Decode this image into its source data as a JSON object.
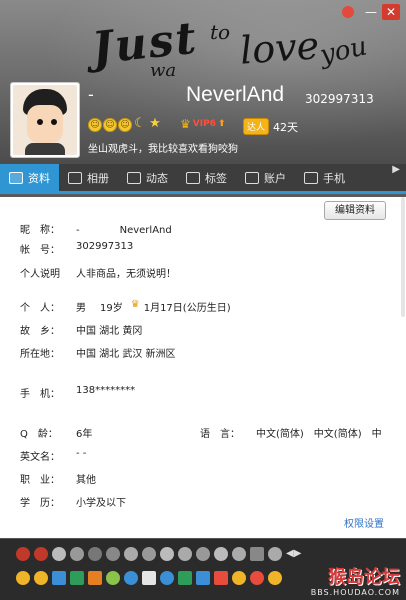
{
  "header": {
    "deco_words": [
      "Just",
      "to",
      "love",
      "you",
      "wa"
    ],
    "dash": "-",
    "nickname": "NeverlAnd",
    "qq_number": "302997313",
    "vip_label": "VIP6",
    "daren_label": "达人",
    "days": "42天",
    "signature": "坐山观虎斗，我比较喜欢看狗咬狗"
  },
  "window_controls": [
    "▾",
    "—",
    "✕"
  ],
  "tabs": [
    {
      "label": "资料",
      "active": true
    },
    {
      "label": "相册",
      "active": false
    },
    {
      "label": "动态",
      "active": false
    },
    {
      "label": "标签",
      "active": false
    },
    {
      "label": "账户",
      "active": false
    },
    {
      "label": "手机",
      "active": false
    }
  ],
  "profile": {
    "edit_button": "编辑资料",
    "nickname_label": "昵　称：",
    "nickname_value": "-　　　　NeverlAnd",
    "account_label": "帐　号：",
    "account_value": "302997313",
    "desc_label": "个人说明",
    "desc_value": "人非商品，无须说明！",
    "person_label": "个　人：",
    "gender": "男",
    "age": "19岁",
    "birthday": "1月17日(公历生日)",
    "hometown_label": "故　乡：",
    "hometown_value": "中国 湖北 黄冈",
    "location_label": "所在地：",
    "location_value": "中国 湖北 武汉 新洲区",
    "phone_label": "手　机：",
    "phone_value": "138********",
    "qage_label": "Q　龄：",
    "qage_value": "6年",
    "lang_label": "语　言：",
    "lang_value": "中文(简体)　中文(简体)　中",
    "en_name_label": "英文名：",
    "en_name_value": "- -",
    "job_label": "职　业：",
    "job_value": "其他",
    "edu_label": "学　历：",
    "edu_value": "小学及以下",
    "perm_link": "权限设置"
  },
  "watermark": {
    "cn": "猴岛论坛",
    "url": "BBS.HOUDAO.COM"
  }
}
